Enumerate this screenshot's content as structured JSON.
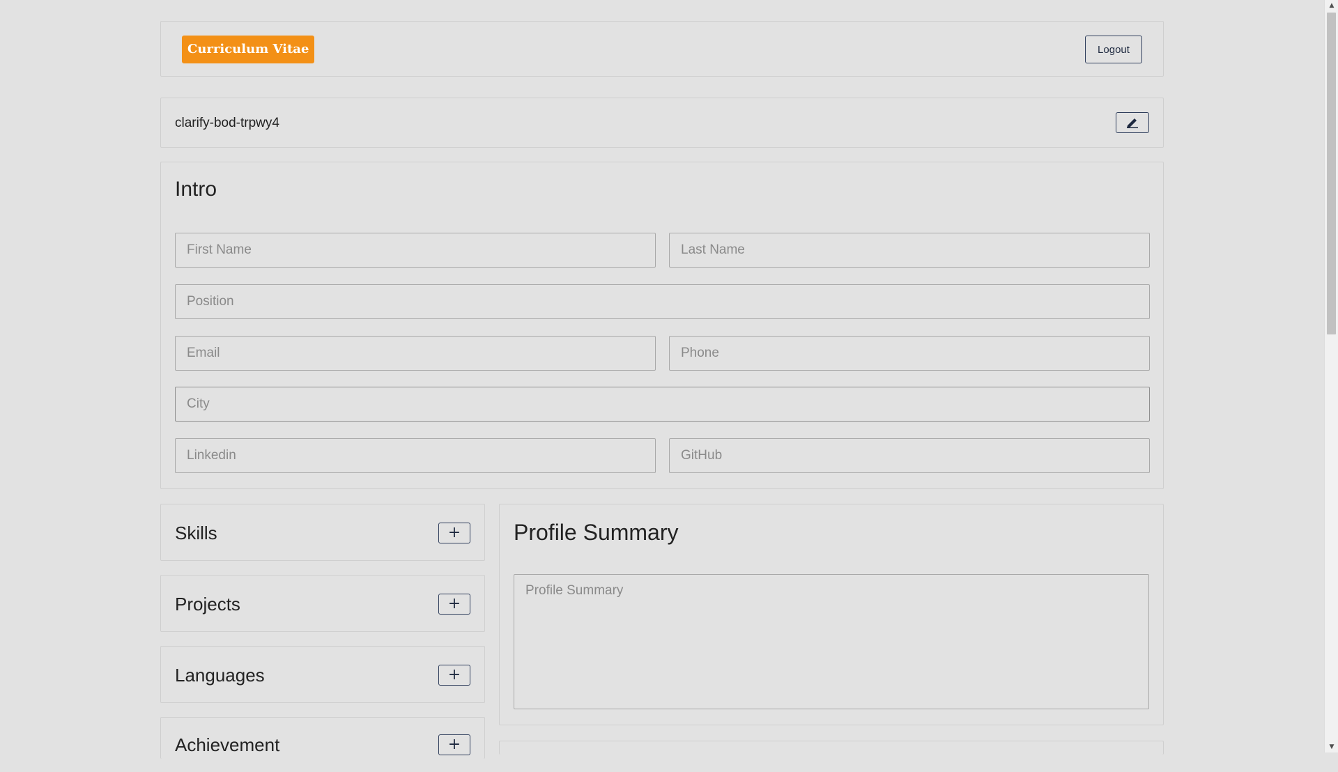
{
  "header": {
    "brand_label": "Curriculum Vitae",
    "logout_label": "Logout"
  },
  "document": {
    "title": "clarify-bod-trpwy4",
    "edit_icon": "pencil-icon"
  },
  "intro": {
    "heading": "Intro",
    "fields": {
      "first_name": "First Name",
      "last_name": "Last Name",
      "position": "Position",
      "email": "Email",
      "phone": "Phone",
      "city": "City",
      "linkedin": "Linkedin",
      "github": "GitHub"
    }
  },
  "sections": {
    "skills": "Skills",
    "projects": "Projects",
    "languages": "Languages",
    "achievement": "Achievement",
    "add_symbol": "+"
  },
  "profile_summary": {
    "heading": "Profile Summary",
    "placeholder": "Profile Summary"
  },
  "colors": {
    "brand": "#f39016",
    "button_border": "#2f3e5c",
    "background": "#e2e2e2"
  }
}
